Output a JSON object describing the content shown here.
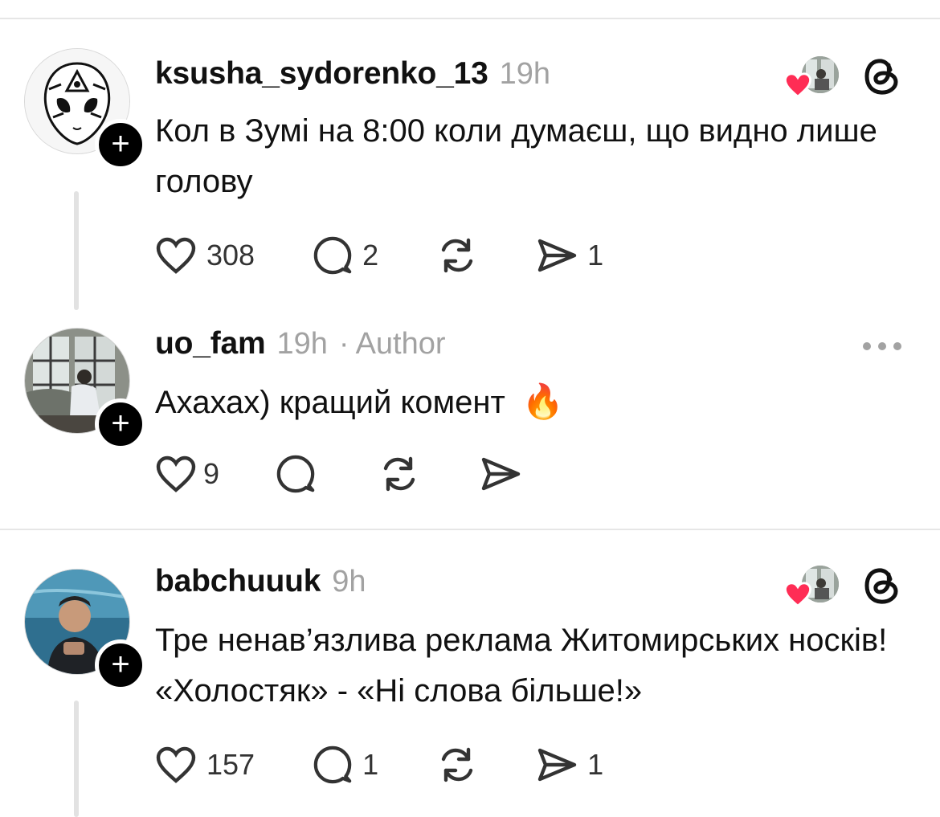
{
  "posts": [
    {
      "username": "ksusha_sydorenko_13",
      "time": "19h",
      "text": "Кол в Зумі на 8:00 коли думаєш, що видно лише голову",
      "likes": "308",
      "replies": "2",
      "shares": "1",
      "avatar_icon": "alien-icon"
    },
    {
      "username": "uo_fam",
      "time": "19h",
      "separator": "·",
      "author_label": "Author",
      "text": "Ахахах) кращий комент",
      "emoji": "🔥",
      "likes": "9",
      "avatar_icon": "window-photo"
    },
    {
      "username": "babchuuuk",
      "time": "9h",
      "text": "Тре ненав’язлива реклама Житомирських носків! «Холостяк» - «Ні слова більше!»",
      "likes": "157",
      "replies": "1",
      "shares": "1",
      "avatar_icon": "aquarium-photo"
    }
  ],
  "plus_symbol": "+",
  "colors": {
    "heart": "#ff2d55",
    "muted": "#a2a2a2",
    "divider": "#e6e6e6"
  }
}
